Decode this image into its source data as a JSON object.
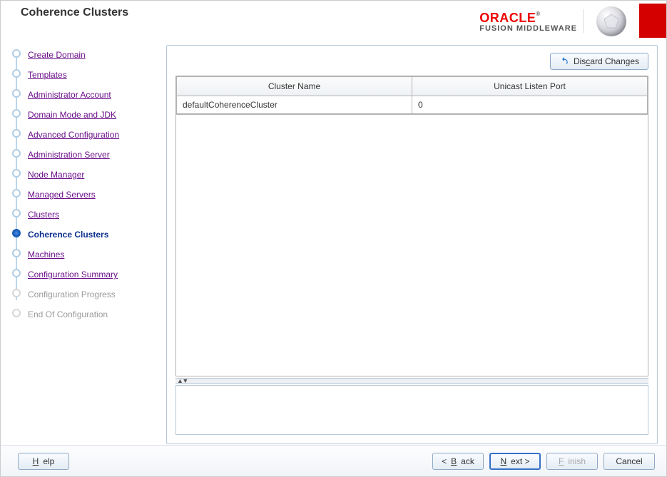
{
  "header": {
    "page_title": "Coherence Clusters",
    "brand_main": "ORACLE",
    "brand_sub": "FUSION MIDDLEWARE"
  },
  "sidebar": {
    "items": [
      {
        "label": "Create Domain",
        "state": "link"
      },
      {
        "label": "Templates",
        "state": "link"
      },
      {
        "label": "Administrator Account",
        "state": "link"
      },
      {
        "label": "Domain Mode and JDK",
        "state": "link"
      },
      {
        "label": "Advanced Configuration",
        "state": "link"
      },
      {
        "label": "Administration Server",
        "state": "link"
      },
      {
        "label": "Node Manager",
        "state": "link"
      },
      {
        "label": "Managed Servers",
        "state": "link"
      },
      {
        "label": "Clusters",
        "state": "link"
      },
      {
        "label": "Coherence Clusters",
        "state": "current"
      },
      {
        "label": "Machines",
        "state": "link"
      },
      {
        "label": "Configuration Summary",
        "state": "link"
      },
      {
        "label": "Configuration Progress",
        "state": "disabled"
      },
      {
        "label": "End Of Configuration",
        "state": "disabled"
      }
    ]
  },
  "main": {
    "discard_label": "Discard Changes",
    "table": {
      "columns": [
        "Cluster Name",
        "Unicast Listen Port"
      ],
      "rows": [
        {
          "cluster_name": "defaultCoherenceCluster",
          "unicast_port": "0"
        }
      ]
    }
  },
  "footer": {
    "help": "Help",
    "back": "Back",
    "next": "Next",
    "finish": "Finish",
    "cancel": "Cancel"
  }
}
